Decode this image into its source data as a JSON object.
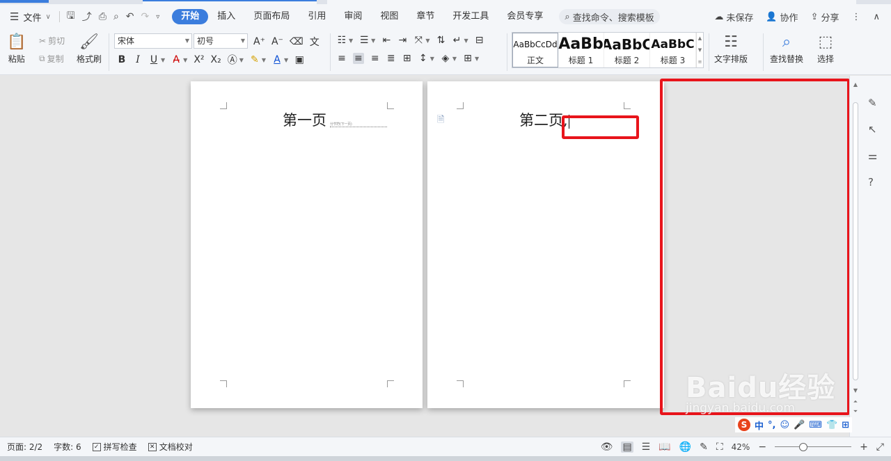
{
  "menubar": {
    "file_label": "文件",
    "tabs": [
      {
        "label": "开始",
        "active": true
      },
      {
        "label": "插入"
      },
      {
        "label": "页面布局"
      },
      {
        "label": "引用"
      },
      {
        "label": "审阅"
      },
      {
        "label": "视图"
      },
      {
        "label": "章节"
      },
      {
        "label": "开发工具"
      },
      {
        "label": "会员专享"
      }
    ],
    "search_placeholder": "查找命令、搜索模板",
    "unsaved": "未保存",
    "collab": "协作",
    "share": "分享"
  },
  "ribbon": {
    "paste": "粘贴",
    "cut": "剪切",
    "copy": "复制",
    "format_painter": "格式刷",
    "font_name": "宋体",
    "font_size": "初号",
    "styles": [
      {
        "sample": "AaBbCcDd",
        "label": "正文"
      },
      {
        "sample": "AaBb",
        "label": "标题 1"
      },
      {
        "sample": "AaBbC",
        "label": "标题 2"
      },
      {
        "sample": "AaBbC",
        "label": "标题 3"
      }
    ],
    "text_layout": "文字排版",
    "find_replace": "查找替换",
    "select": "选择"
  },
  "document": {
    "page1_text": "第一页",
    "page1_break": "分节符(下一页)",
    "page2_text": "第二页",
    "cursor_char": ","
  },
  "status": {
    "page": "页面: 2/2",
    "words": "字数: 6",
    "spell": "拼写检查",
    "proof": "文档校对",
    "zoom": "42%",
    "zoom_level": 0.42
  },
  "ime": {
    "logo": "S",
    "mode": "中"
  },
  "watermark": {
    "main": "Baidu经验",
    "sub": "jingyan.baidu.com"
  },
  "colors": {
    "accent": "#3b7ddd",
    "highlight_box": "#e8141b"
  }
}
